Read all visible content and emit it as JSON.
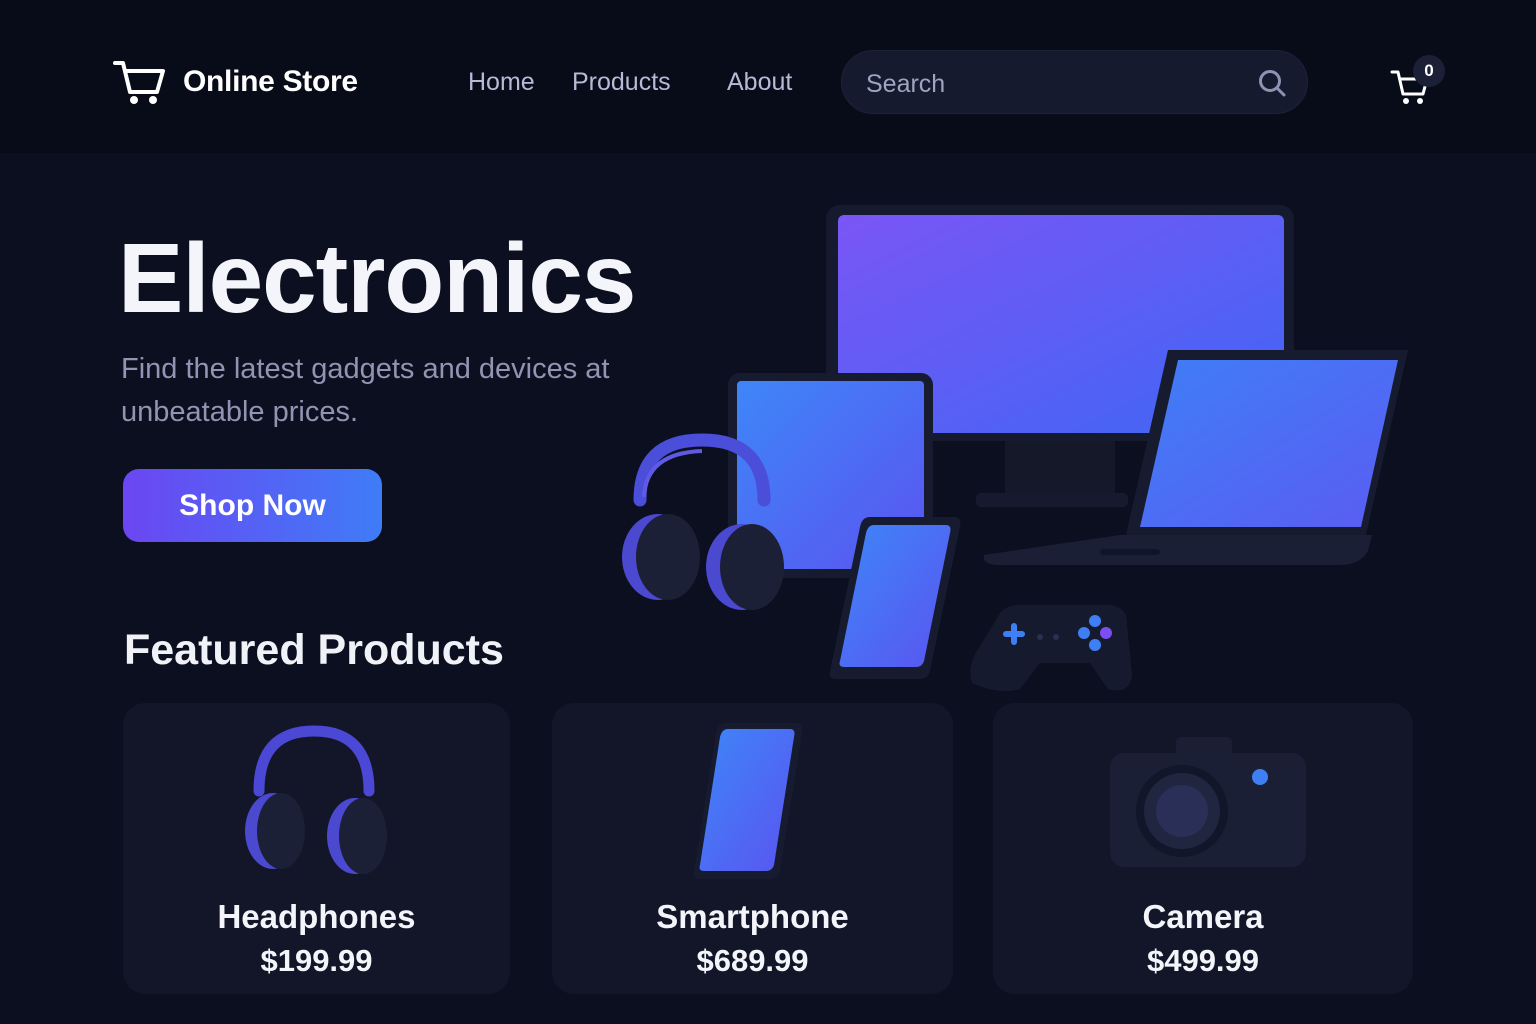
{
  "header": {
    "logo_text": "Online Store",
    "logo_icon": "shopping-cart-icon",
    "nav": [
      {
        "label": "Home"
      },
      {
        "label": "Products"
      },
      {
        "label": "About"
      }
    ],
    "search": {
      "placeholder": "Search",
      "icon": "search-icon"
    },
    "cart": {
      "icon": "shopping-cart-icon",
      "count": "0"
    }
  },
  "hero": {
    "title": "Electronics",
    "subtitle": "Find the latest gadgets and devices at unbeatable prices.",
    "cta_label": "Shop Now"
  },
  "featured": {
    "title": "Featured Products",
    "products": [
      {
        "name": "Headphones",
        "price": "$199.99",
        "icon": "headphones-icon"
      },
      {
        "name": "Smartphone",
        "price": "$689.99",
        "icon": "smartphone-icon"
      },
      {
        "name": "Camera",
        "price": "$499.99",
        "icon": "camera-icon"
      }
    ]
  },
  "colors": {
    "background": "#0c0f1f",
    "header": "#080b18",
    "accent_start": "#6b46f2",
    "accent_end": "#3f7cf7"
  }
}
